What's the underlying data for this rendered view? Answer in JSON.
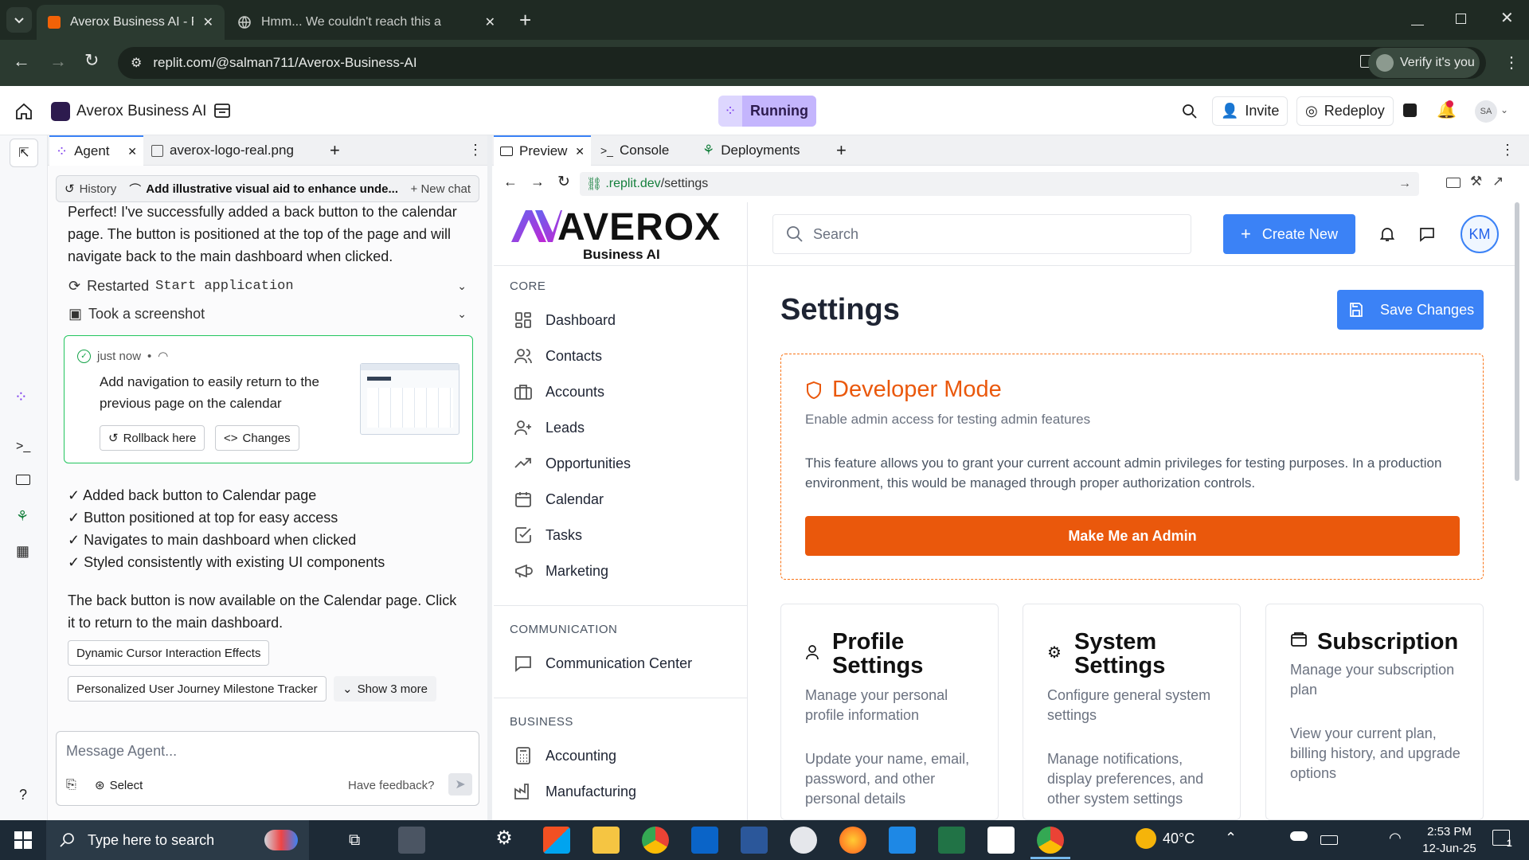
{
  "browser": {
    "tabs": [
      {
        "title": "Averox Business AI - Replit",
        "active": true
      },
      {
        "title": "Hmm... We couldn't reach this a",
        "active": false
      }
    ],
    "url": "replit.com/@salman711/Averox-Business-AI",
    "verify_label": "Verify it's you"
  },
  "replit_header": {
    "repl_name": "Averox Business AI",
    "status": "Running",
    "invite_label": "Invite",
    "redeploy_label": "Redeploy",
    "avatar_initials": "SA"
  },
  "agent_panel": {
    "tabs": [
      "Agent",
      "averox-logo-real.png"
    ],
    "history_label": "History",
    "chat_title": "Add illustrative visual aid to enhance unde...",
    "new_chat_label": "New chat",
    "message_intro": "Perfect! I've successfully added a back button to the calendar page. The button is positioned at the top of the page and will navigate back to the main dashboard when clicked.",
    "actions": [
      {
        "prefix": "Restarted",
        "code": "Start application"
      },
      {
        "prefix": "Took a screenshot",
        "code": ""
      }
    ],
    "checkpoint": {
      "time": "just now",
      "separator": "•",
      "text": "Add navigation to easily return to the previous page on the calendar",
      "rollback_label": "Rollback here",
      "changes_label": "Changes"
    },
    "checklist": [
      "✓ Added back button to Calendar page",
      "✓ Button positioned at top for easy access",
      "✓ Navigates to main dashboard when clicked",
      "✓ Styled consistently with existing UI components"
    ],
    "summary": "The back button is now available on the Calendar page. Click it to return to the main dashboard.",
    "suggestions": [
      "Dynamic Cursor Interaction Effects",
      "Personalized User Journey Milestone Tracker"
    ],
    "show_more_label": "Show 3 more",
    "input_placeholder": "Message Agent...",
    "select_label": "Select",
    "feedback_label": "Have feedback?"
  },
  "preview_panel": {
    "tabs": [
      "Preview",
      "Console",
      "Deployments"
    ],
    "url_domain": ".replit.dev",
    "url_path": "/settings"
  },
  "app": {
    "logo_text": "AVEROX",
    "logo_sub": "Business AI",
    "search_placeholder": "Search",
    "create_label": "Create New",
    "user_initials": "KM",
    "sections": [
      {
        "label": "CORE",
        "items": [
          "Dashboard",
          "Contacts",
          "Accounts",
          "Leads",
          "Opportunities",
          "Calendar",
          "Tasks",
          "Marketing"
        ]
      },
      {
        "label": "COMMUNICATION",
        "items": [
          "Communication Center"
        ]
      },
      {
        "label": "BUSINESS",
        "items": [
          "Accounting",
          "Manufacturing"
        ]
      }
    ],
    "page_title": "Settings",
    "save_label": "Save Changes",
    "dev_mode": {
      "title": "Developer Mode",
      "subtitle": "Enable admin access for testing admin features",
      "body": "This feature allows you to grant your current account admin privileges for testing purposes. In a production environment, this would be managed through proper authorization controls.",
      "button": "Make Me an Admin"
    },
    "cards": [
      {
        "title": "Profile Settings",
        "desc": "Manage your personal profile information",
        "body": "Update your name, email, password, and other personal details"
      },
      {
        "title": "System Settings",
        "desc": "Configure general system settings",
        "body": "Manage notifications, display preferences, and other system settings"
      },
      {
        "title": "Subscription",
        "desc": "Manage your subscription plan",
        "body": "View your current plan, billing history, and upgrade options"
      }
    ]
  },
  "taskbar": {
    "search_placeholder": "Type here to search",
    "weather": "40°C",
    "time": "2:53 PM",
    "date": "12-Jun-25",
    "notification_count": "1"
  },
  "colors": {
    "accent_blue": "#3b82f6",
    "orange": "#ea580c",
    "running_bg": "#c4b5fd"
  }
}
